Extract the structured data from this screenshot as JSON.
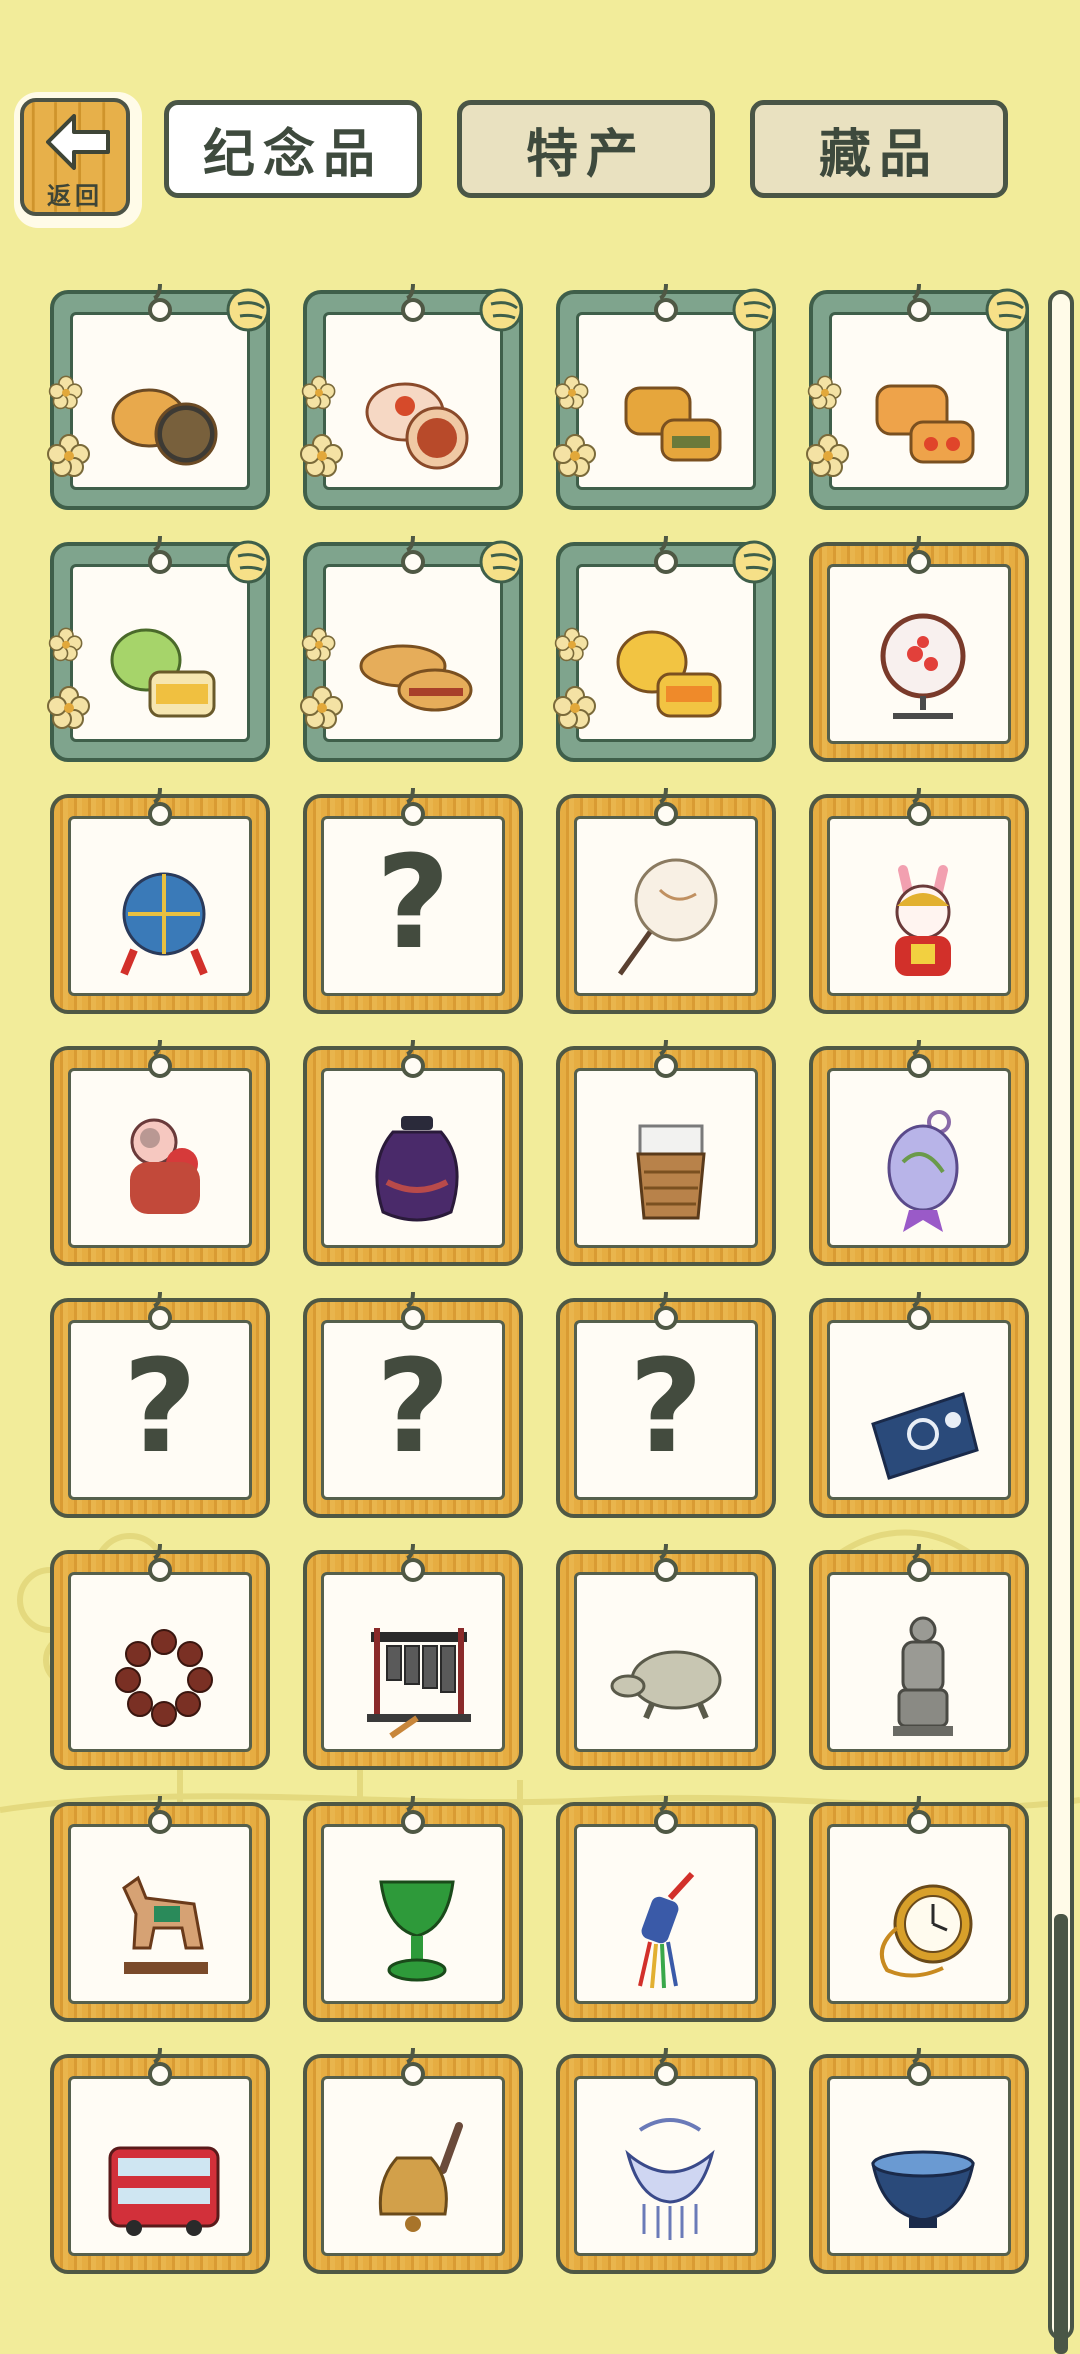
{
  "back_button": {
    "label": "返回",
    "icon": "left-arrow-icon"
  },
  "tabs": [
    {
      "label": "纪念品",
      "active": true
    },
    {
      "label": "特产",
      "active": false
    },
    {
      "label": "藏品",
      "active": false
    }
  ],
  "colors": {
    "background": "#f2ec9a",
    "wood_frame": "#e6ad42",
    "jade_frame": "#7fa48d",
    "outline": "#4a5646"
  },
  "grid": {
    "items": [
      {
        "name": "mooncake-black-sesame",
        "frame": "jade",
        "unknown": false
      },
      {
        "name": "mooncake-red-bean",
        "frame": "jade",
        "unknown": false
      },
      {
        "name": "mooncake-yolk-lotus",
        "frame": "jade",
        "unknown": false
      },
      {
        "name": "mooncake-double-yolk",
        "frame": "jade",
        "unknown": false
      },
      {
        "name": "mooncake-green-tea",
        "frame": "jade",
        "unknown": false
      },
      {
        "name": "mooncake-pastry",
        "frame": "jade",
        "unknown": false
      },
      {
        "name": "mooncake-orange",
        "frame": "jade",
        "unknown": false
      },
      {
        "name": "embroidery-screen",
        "frame": "wood",
        "unknown": false
      },
      {
        "name": "hydrangea-ball",
        "frame": "wood",
        "unknown": false
      },
      {
        "name": "unknown-item",
        "frame": "wood",
        "unknown": true,
        "label": "?"
      },
      {
        "name": "round-fan",
        "frame": "wood",
        "unknown": false
      },
      {
        "name": "rabbit-god-figure",
        "frame": "wood",
        "unknown": false
      },
      {
        "name": "clay-doll",
        "frame": "wood",
        "unknown": false
      },
      {
        "name": "jun-porcelain-jar",
        "frame": "wood",
        "unknown": false
      },
      {
        "name": "bamboo-cup",
        "frame": "wood",
        "unknown": false
      },
      {
        "name": "cloisonne-sachet",
        "frame": "wood",
        "unknown": false
      },
      {
        "name": "unknown-item",
        "frame": "wood",
        "unknown": true,
        "label": "?"
      },
      {
        "name": "unknown-item",
        "frame": "wood",
        "unknown": true,
        "label": "?"
      },
      {
        "name": "unknown-item",
        "frame": "wood",
        "unknown": true,
        "label": "?"
      },
      {
        "name": "blue-dyed-cloth",
        "frame": "wood",
        "unknown": false
      },
      {
        "name": "prayer-beads",
        "frame": "wood",
        "unknown": false
      },
      {
        "name": "chime-bells",
        "frame": "wood",
        "unknown": false
      },
      {
        "name": "stone-turtle",
        "frame": "wood",
        "unknown": false
      },
      {
        "name": "terracotta-warrior",
        "frame": "wood",
        "unknown": false
      },
      {
        "name": "tang-horse",
        "frame": "wood",
        "unknown": false
      },
      {
        "name": "jade-goblet",
        "frame": "wood",
        "unknown": false
      },
      {
        "name": "chinese-knot-tassel",
        "frame": "wood",
        "unknown": false
      },
      {
        "name": "pocket-watch",
        "frame": "wood",
        "unknown": false
      },
      {
        "name": "double-decker-bus",
        "frame": "wood",
        "unknown": false
      },
      {
        "name": "brass-bell",
        "frame": "wood",
        "unknown": false
      },
      {
        "name": "silver-necklace",
        "frame": "wood",
        "unknown": false
      },
      {
        "name": "tea-bowl",
        "frame": "wood",
        "unknown": false
      }
    ]
  },
  "scrollbar": {
    "position_fraction": 0.79
  }
}
